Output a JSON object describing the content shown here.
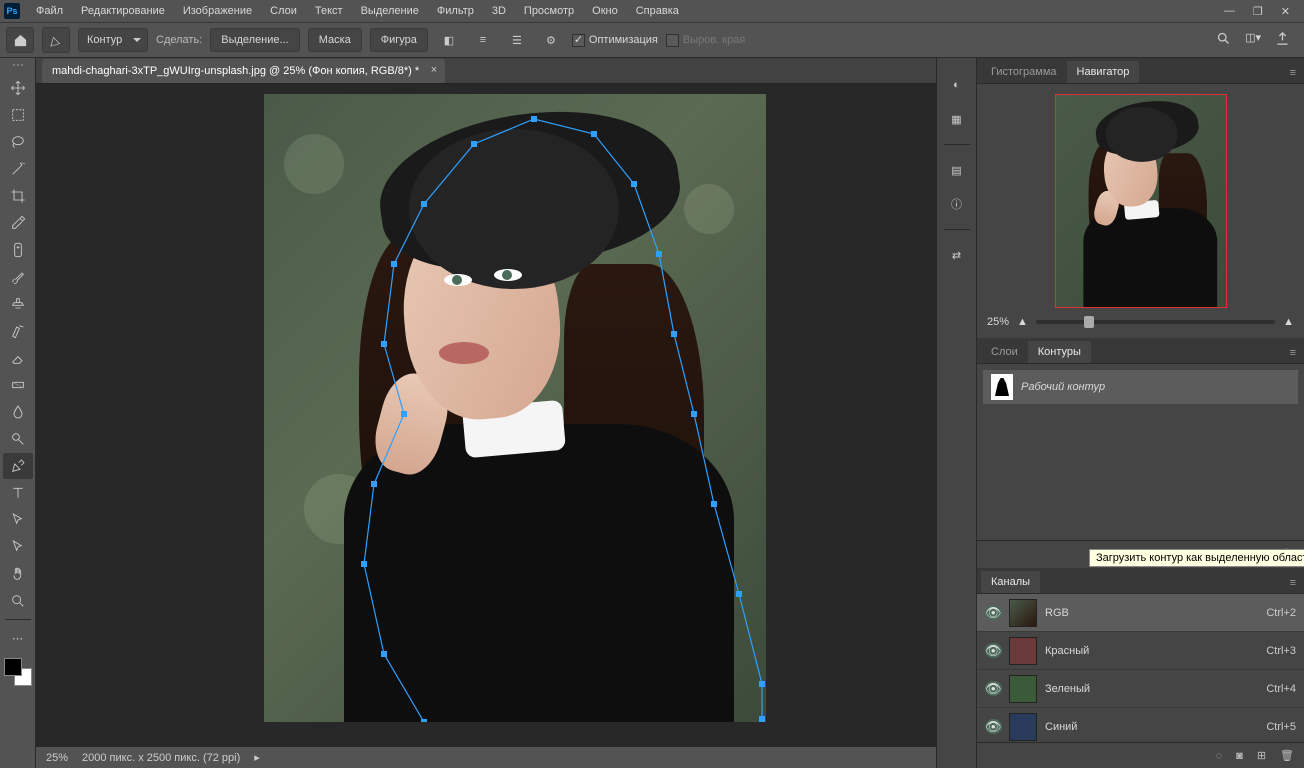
{
  "menu": {
    "items": [
      "Файл",
      "Редактирование",
      "Изображение",
      "Слои",
      "Текст",
      "Выделение",
      "Фильтр",
      "3D",
      "Просмотр",
      "Окно",
      "Справка"
    ]
  },
  "options": {
    "mode_label": "Контур",
    "make_label": "Сделать:",
    "btn_selection": "Выделение...",
    "btn_mask": "Маска",
    "btn_shape": "Фигура",
    "opt_optimize": "Оптимизация",
    "opt_rubber": "Выров. края"
  },
  "document": {
    "tab_title": "mahdi-chaghari-3xTP_gWUIrg-unsplash.jpg @ 25% (Фон копия, RGB/8*) *"
  },
  "status": {
    "zoom": "25%",
    "docinfo": "2000 пикс. x 2500 пикс. (72 ppi)"
  },
  "panels": {
    "histogram_tab": "Гистограмма",
    "navigator_tab": "Навигатор",
    "nav_zoom": "25%",
    "layers_tab": "Слои",
    "paths_tab": "Контуры",
    "path_item_name": "Рабочий контур",
    "paths_tooltip": "Загрузить контур как выделенную область",
    "channels_tab": "Каналы",
    "channels": [
      {
        "name": "RGB",
        "shortcut": "Ctrl+2",
        "color": "rgb"
      },
      {
        "name": "Красный",
        "shortcut": "Ctrl+3",
        "color": "red"
      },
      {
        "name": "Зеленый",
        "shortcut": "Ctrl+4",
        "color": "green"
      },
      {
        "name": "Синий",
        "shortcut": "Ctrl+5",
        "color": "blue"
      }
    ]
  }
}
